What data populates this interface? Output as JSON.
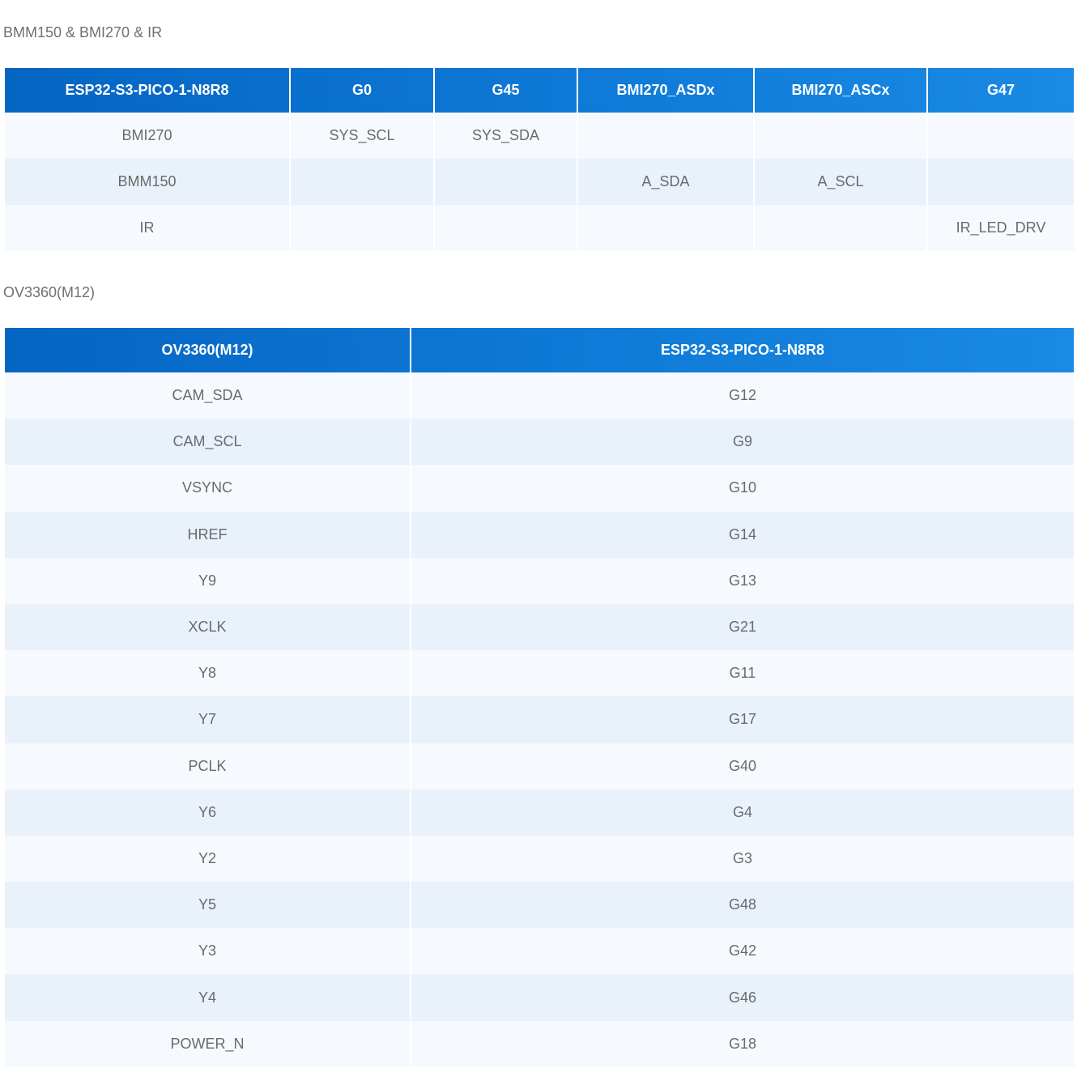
{
  "section1": {
    "title": "BMM150 & BMI270 & IR",
    "headers": [
      "ESP32-S3-PICO-1-N8R8",
      "G0",
      "G45",
      "BMI270_ASDx",
      "BMI270_ASCx",
      "G47"
    ],
    "rows": [
      [
        "BMI270",
        "SYS_SCL",
        "SYS_SDA",
        "",
        "",
        ""
      ],
      [
        "BMM150",
        "",
        "",
        "A_SDA",
        "A_SCL",
        ""
      ],
      [
        "IR",
        "",
        "",
        "",
        "",
        "IR_LED_DRV"
      ]
    ]
  },
  "section2": {
    "title": "OV3360(M12)",
    "headers": [
      "OV3360(M12)",
      "ESP32-S3-PICO-1-N8R8"
    ],
    "rows": [
      [
        "CAM_SDA",
        "G12"
      ],
      [
        "CAM_SCL",
        "G9"
      ],
      [
        "VSYNC",
        "G10"
      ],
      [
        "HREF",
        "G14"
      ],
      [
        "Y9",
        "G13"
      ],
      [
        "XCLK",
        "G21"
      ],
      [
        "Y8",
        "G11"
      ],
      [
        "Y7",
        "G17"
      ],
      [
        "PCLK",
        "G40"
      ],
      [
        "Y6",
        "G4"
      ],
      [
        "Y2",
        "G3"
      ],
      [
        "Y5",
        "G48"
      ],
      [
        "Y3",
        "G42"
      ],
      [
        "Y4",
        "G46"
      ],
      [
        "POWER_N",
        "G18"
      ]
    ]
  },
  "colors": {
    "header_gradient_start": "#0565c3",
    "header_gradient_end": "#1a8ae4",
    "row_odd": "#f6f9fd",
    "row_even": "#e9f1fb",
    "cell_text": "#6a6a6a"
  }
}
